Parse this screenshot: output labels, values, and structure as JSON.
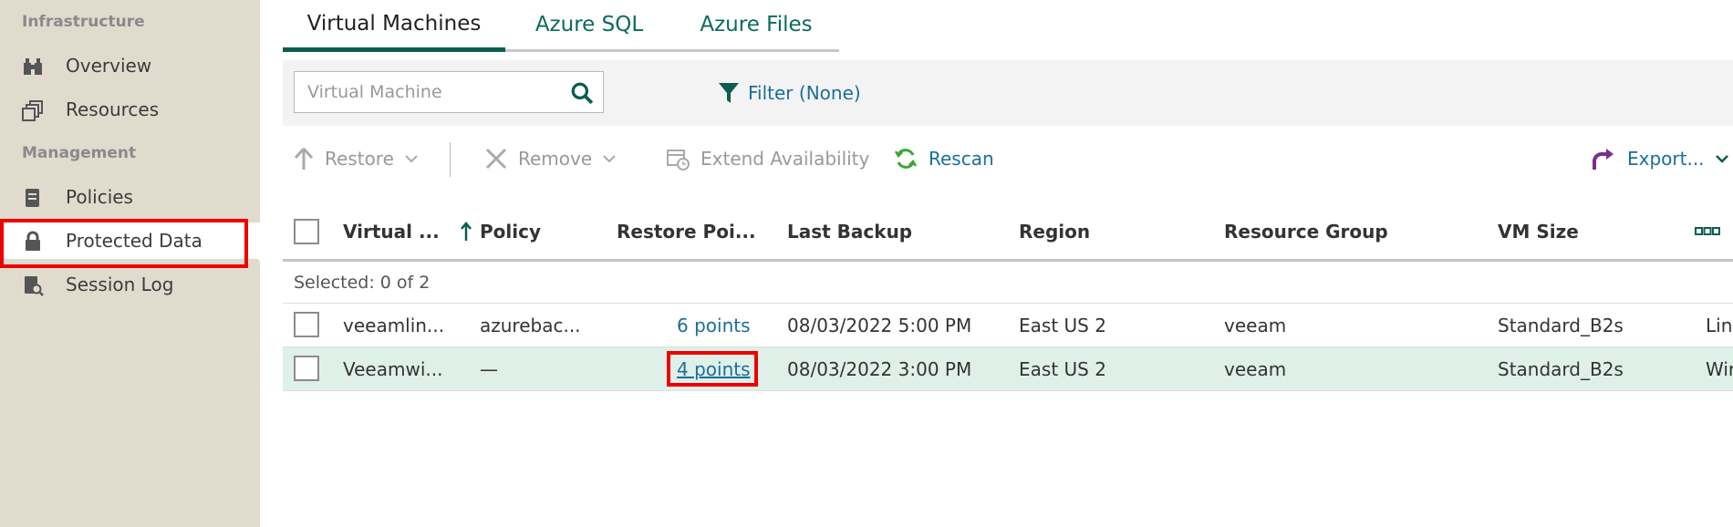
{
  "sidebar": {
    "section_infrastructure": "Infrastructure",
    "section_management": "Management",
    "items": [
      {
        "label": "Overview",
        "icon": "binoculars-icon"
      },
      {
        "label": "Resources",
        "icon": "resources-icon"
      },
      {
        "label": "Policies",
        "icon": "policies-icon"
      },
      {
        "label": "Protected Data",
        "icon": "lock-icon"
      },
      {
        "label": "Session Log",
        "icon": "session-log-icon"
      }
    ]
  },
  "tabs": [
    {
      "label": "Virtual Machines",
      "active": true
    },
    {
      "label": "Azure SQL",
      "active": false
    },
    {
      "label": "Azure Files",
      "active": false
    }
  ],
  "search": {
    "placeholder": "Virtual Machine",
    "value": ""
  },
  "filter": {
    "label": "Filter (None)"
  },
  "toolbar": {
    "restore": "Restore",
    "remove": "Remove",
    "extend": "Extend Availability",
    "rescan": "Rescan",
    "export": "Export..."
  },
  "table": {
    "columns": [
      "Virtual ...",
      "Policy",
      "Restore Poi...",
      "Last Backup",
      "Region",
      "Resource Group",
      "VM Size"
    ],
    "selected_text": "Selected:  0 of 2",
    "rows": [
      {
        "name": "veeamlin...",
        "policy": "azurebac...",
        "points": "6 points",
        "last_backup": "08/03/2022 5:00 PM",
        "region": "East US 2",
        "group": "veeam",
        "size": "Standard_B2s",
        "os": "Lin"
      },
      {
        "name": "Veeamwi...",
        "policy": "—",
        "points": "4 points",
        "last_backup": "08/03/2022 3:00 PM",
        "region": "East US 2",
        "group": "veeam",
        "size": "Standard_B2s",
        "os": "Wir"
      }
    ]
  },
  "colors": {
    "accent": "#0b5e4f",
    "link": "#1a6e9c",
    "highlight": "#e00000"
  }
}
